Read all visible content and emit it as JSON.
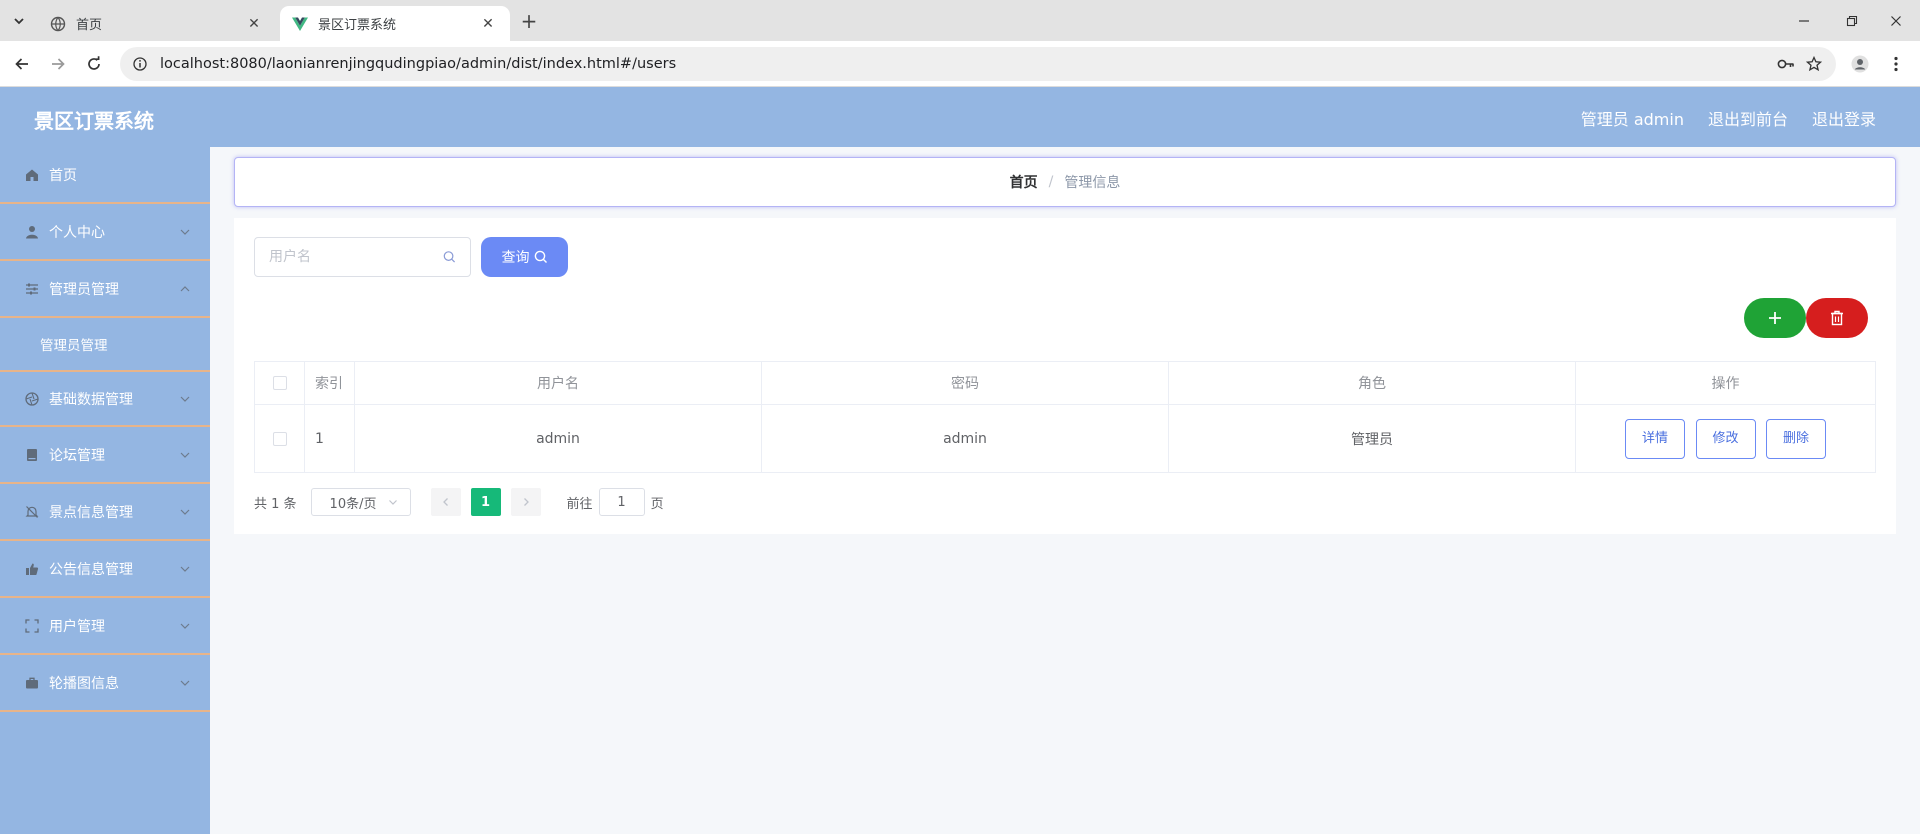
{
  "browser": {
    "tabs": [
      {
        "title": "首页",
        "active": false,
        "icon": "globe-icon"
      },
      {
        "title": "景区订票系统",
        "active": true,
        "icon": "vue-logo-icon"
      }
    ],
    "url": "localhost:8080/laonianrenjingqudingpiao/admin/dist/index.html#/users",
    "close_symbol": "✕",
    "new_tab_symbol": "+"
  },
  "header": {
    "title": "景区订票系统",
    "user_label": "管理员 admin",
    "front_link": "退出到前台",
    "logout_link": "退出登录",
    "bg_color": "#94b6e2"
  },
  "sidebar": {
    "items": [
      {
        "label": "首页",
        "icon": "home-icon"
      },
      {
        "label": "个人中心",
        "icon": "user-icon"
      },
      {
        "label": "管理员管理",
        "icon": "sliders-icon"
      },
      {
        "label": "管理员管理",
        "icon": "",
        "sub": true
      },
      {
        "label": "基础数据管理",
        "icon": "aperture-icon"
      },
      {
        "label": "论坛管理",
        "icon": "notebook-icon"
      },
      {
        "label": "景点信息管理",
        "icon": "bell-off-icon"
      },
      {
        "label": "公告信息管理",
        "icon": "thumb-up-icon"
      },
      {
        "label": "用户管理",
        "icon": "fullscreen-icon"
      },
      {
        "label": "轮播图信息",
        "icon": "briefcase-icon"
      }
    ],
    "divider_color": "#e7b48a"
  },
  "breadcrumb": {
    "home": "首页",
    "separator": "/",
    "current": "管理信息"
  },
  "search": {
    "placeholder": "用户名",
    "button_label": "查询"
  },
  "table": {
    "headers": [
      "索引",
      "用户名",
      "密码",
      "角色",
      "操作"
    ],
    "rows": [
      {
        "index": "1",
        "username": "admin",
        "password": "admin",
        "role": "管理员"
      }
    ],
    "actions": [
      "详情",
      "修改",
      "删除"
    ]
  },
  "pagination": {
    "total": "共 1 条",
    "page_size": "10条/页",
    "current_page": "1",
    "goto_prefix": "前往",
    "goto_value": "1",
    "goto_suffix": "页",
    "active_color": "#16b979"
  },
  "colors": {
    "primary": "#6b8af5",
    "add": "#1fa336",
    "delete": "#d61e1e"
  }
}
